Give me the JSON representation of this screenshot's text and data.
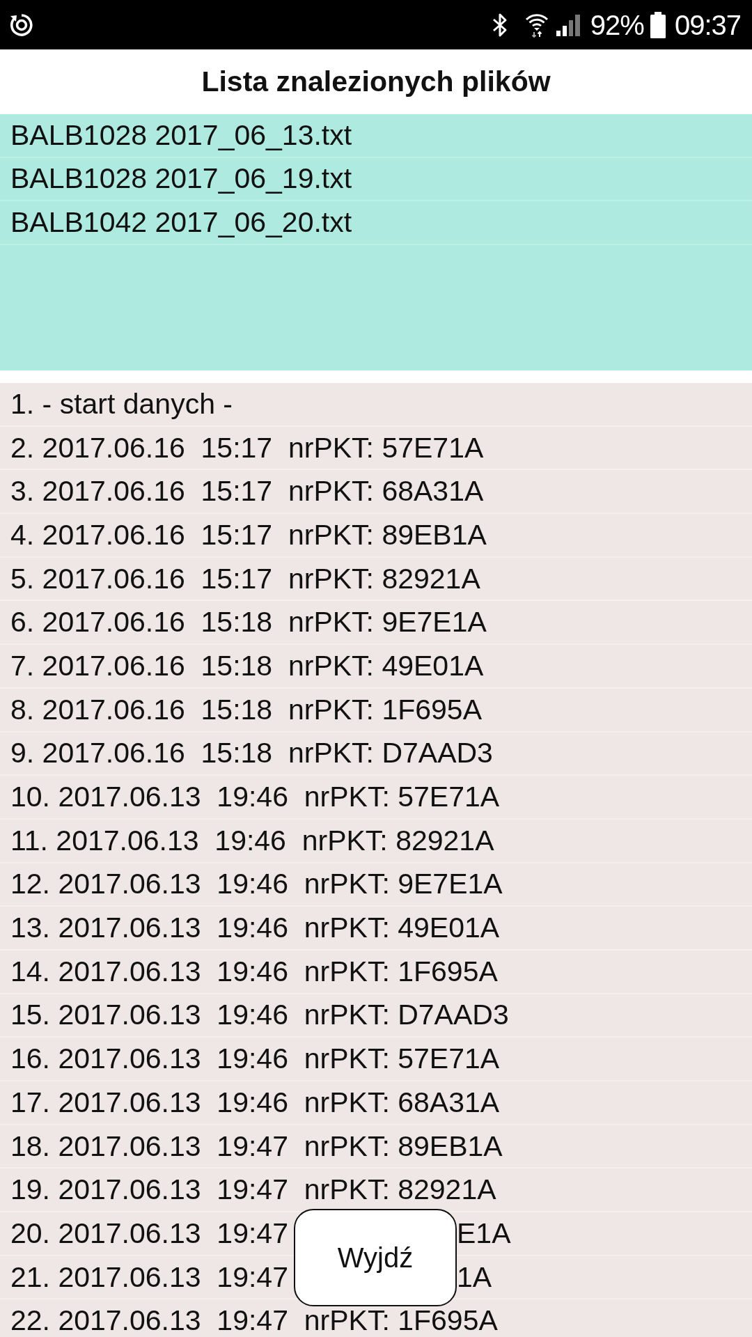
{
  "status_bar": {
    "battery": "92%",
    "time": "09:37"
  },
  "header": {
    "title": "Lista znalezionych plików"
  },
  "files": [
    {
      "name": "BALB1028 2017_06_13.txt"
    },
    {
      "name": "BALB1028 2017_06_19.txt"
    },
    {
      "name": "BALB1042 2017_06_20.txt"
    }
  ],
  "records": [
    {
      "text": "1. - start danych -"
    },
    {
      "text": "2. 2017.06.16  15:17  nrPKT: 57E71A"
    },
    {
      "text": "3. 2017.06.16  15:17  nrPKT: 68A31A"
    },
    {
      "text": "4. 2017.06.16  15:17  nrPKT: 89EB1A"
    },
    {
      "text": "5. 2017.06.16  15:17  nrPKT: 82921A"
    },
    {
      "text": "6. 2017.06.16  15:18  nrPKT: 9E7E1A"
    },
    {
      "text": "7. 2017.06.16  15:18  nrPKT: 49E01A"
    },
    {
      "text": "8. 2017.06.16  15:18  nrPKT: 1F695A"
    },
    {
      "text": "9. 2017.06.16  15:18  nrPKT: D7AAD3"
    },
    {
      "text": "10. 2017.06.13  19:46  nrPKT: 57E71A"
    },
    {
      "text": "11. 2017.06.13  19:46  nrPKT: 82921A"
    },
    {
      "text": "12. 2017.06.13  19:46  nrPKT: 9E7E1A"
    },
    {
      "text": "13. 2017.06.13  19:46  nrPKT: 49E01A"
    },
    {
      "text": "14. 2017.06.13  19:46  nrPKT: 1F695A"
    },
    {
      "text": "15. 2017.06.13  19:46  nrPKT: D7AAD3"
    },
    {
      "text": "16. 2017.06.13  19:46  nrPKT: 57E71A"
    },
    {
      "text": "17. 2017.06.13  19:46  nrPKT: 68A31A"
    },
    {
      "text": "18. 2017.06.13  19:47  nrPKT: 89EB1A"
    },
    {
      "text": "19. 2017.06.13  19:47  nrPKT: 82921A"
    },
    {
      "text": "20. 2017.06.13  19:47",
      "tail": "E1A"
    },
    {
      "text": "21. 2017.06.13  19:47",
      "tail": "1A"
    },
    {
      "text": "22. 2017.06.13  19:47  nrPKT: 1F695A"
    }
  ],
  "exit_button": {
    "label": "Wyjdź"
  }
}
